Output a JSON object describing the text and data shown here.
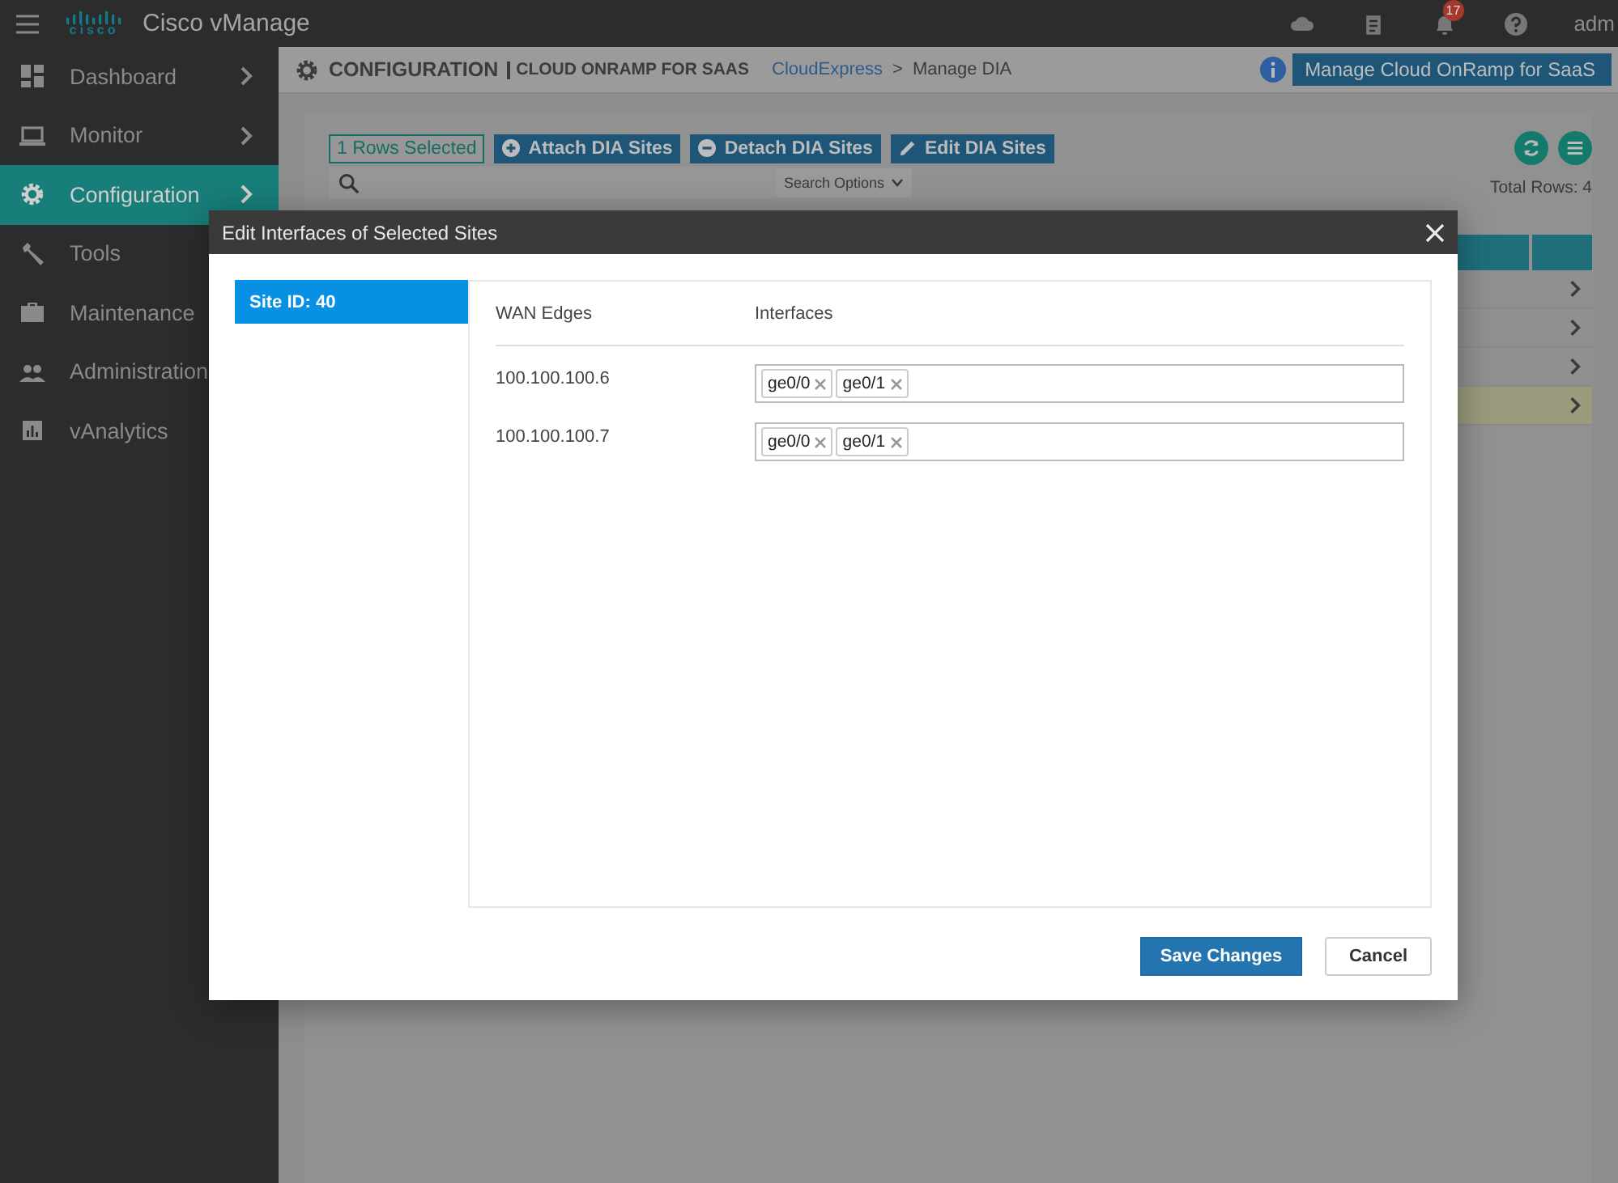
{
  "topbar": {
    "logo_text": "cisco",
    "brand": "Cisco vManage",
    "notifications": "17",
    "user": "adm"
  },
  "sidebar": {
    "items": [
      {
        "label": "Dashboard",
        "expandable": true,
        "selected": false
      },
      {
        "label": "Monitor",
        "expandable": true,
        "selected": false
      },
      {
        "label": "Configuration",
        "expandable": true,
        "selected": true
      },
      {
        "label": "Tools",
        "selected": false
      },
      {
        "label": "Maintenance",
        "selected": false
      },
      {
        "label": "Administration",
        "selected": false
      },
      {
        "label": "vAnalytics",
        "selected": false
      }
    ]
  },
  "header": {
    "title": "CONFIGURATION",
    "subtitle": "CLOUD ONRAMP FOR SAAS",
    "breadcrumb_link": "CloudExpress",
    "separator": ">",
    "current": "Manage DIA",
    "dropdown": "Manage Cloud OnRamp for SaaS"
  },
  "toolbar": {
    "selection": "1 Rows Selected",
    "buttons": [
      {
        "label": "Attach DIA Sites"
      },
      {
        "label": "Detach DIA Sites"
      },
      {
        "label": "Edit DIA Sites"
      }
    ],
    "search_options": "Search Options",
    "total": "Total Rows: 4"
  },
  "table": {
    "rows": [
      {
        "selected": false
      },
      {
        "selected": false
      },
      {
        "selected": false
      },
      {
        "selected": true
      }
    ]
  },
  "modal": {
    "title": "Edit Interfaces of Selected Sites",
    "sites": [
      {
        "label": "Site ID: 40",
        "selected": true
      }
    ],
    "columns": [
      "WAN Edges",
      "Interfaces"
    ],
    "rows": [
      {
        "edge": "100.100.100.6",
        "interfaces": [
          "ge0/0",
          "ge0/1"
        ]
      },
      {
        "edge": "100.100.100.7",
        "interfaces": [
          "ge0/0",
          "ge0/1"
        ]
      }
    ],
    "save": "Save Changes",
    "cancel": "Cancel"
  }
}
